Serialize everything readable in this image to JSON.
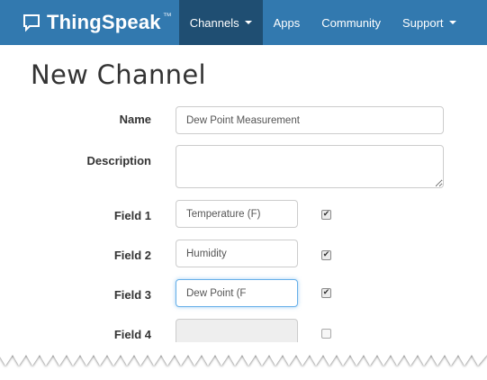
{
  "navbar": {
    "brand_name": "ThingSpeak",
    "brand_tm": "™",
    "items": [
      {
        "label": "Channels",
        "has_caret": true,
        "active": true
      },
      {
        "label": "Apps",
        "has_caret": false,
        "active": false
      },
      {
        "label": "Community",
        "has_caret": false,
        "active": false
      },
      {
        "label": "Support",
        "has_caret": true,
        "active": false
      }
    ],
    "accent_color": "#3279af",
    "active_color": "#1f4e72"
  },
  "page": {
    "title": "New Channel"
  },
  "form": {
    "name_label": "Name",
    "name_value": "Dew Point Measurement",
    "description_label": "Description",
    "description_value": "",
    "fields": [
      {
        "label": "Field 1",
        "value": "Temperature (F)",
        "checked": true
      },
      {
        "label": "Field 2",
        "value": "Humidity",
        "checked": true
      },
      {
        "label": "Field 3",
        "value": "Dew Point (F",
        "checked": true,
        "focused": true
      },
      {
        "label": "Field 4",
        "value": "",
        "checked": false,
        "disabled": true
      }
    ]
  },
  "icons": {
    "brand": "speech-bubble-icon",
    "check": "checkmark-icon"
  }
}
